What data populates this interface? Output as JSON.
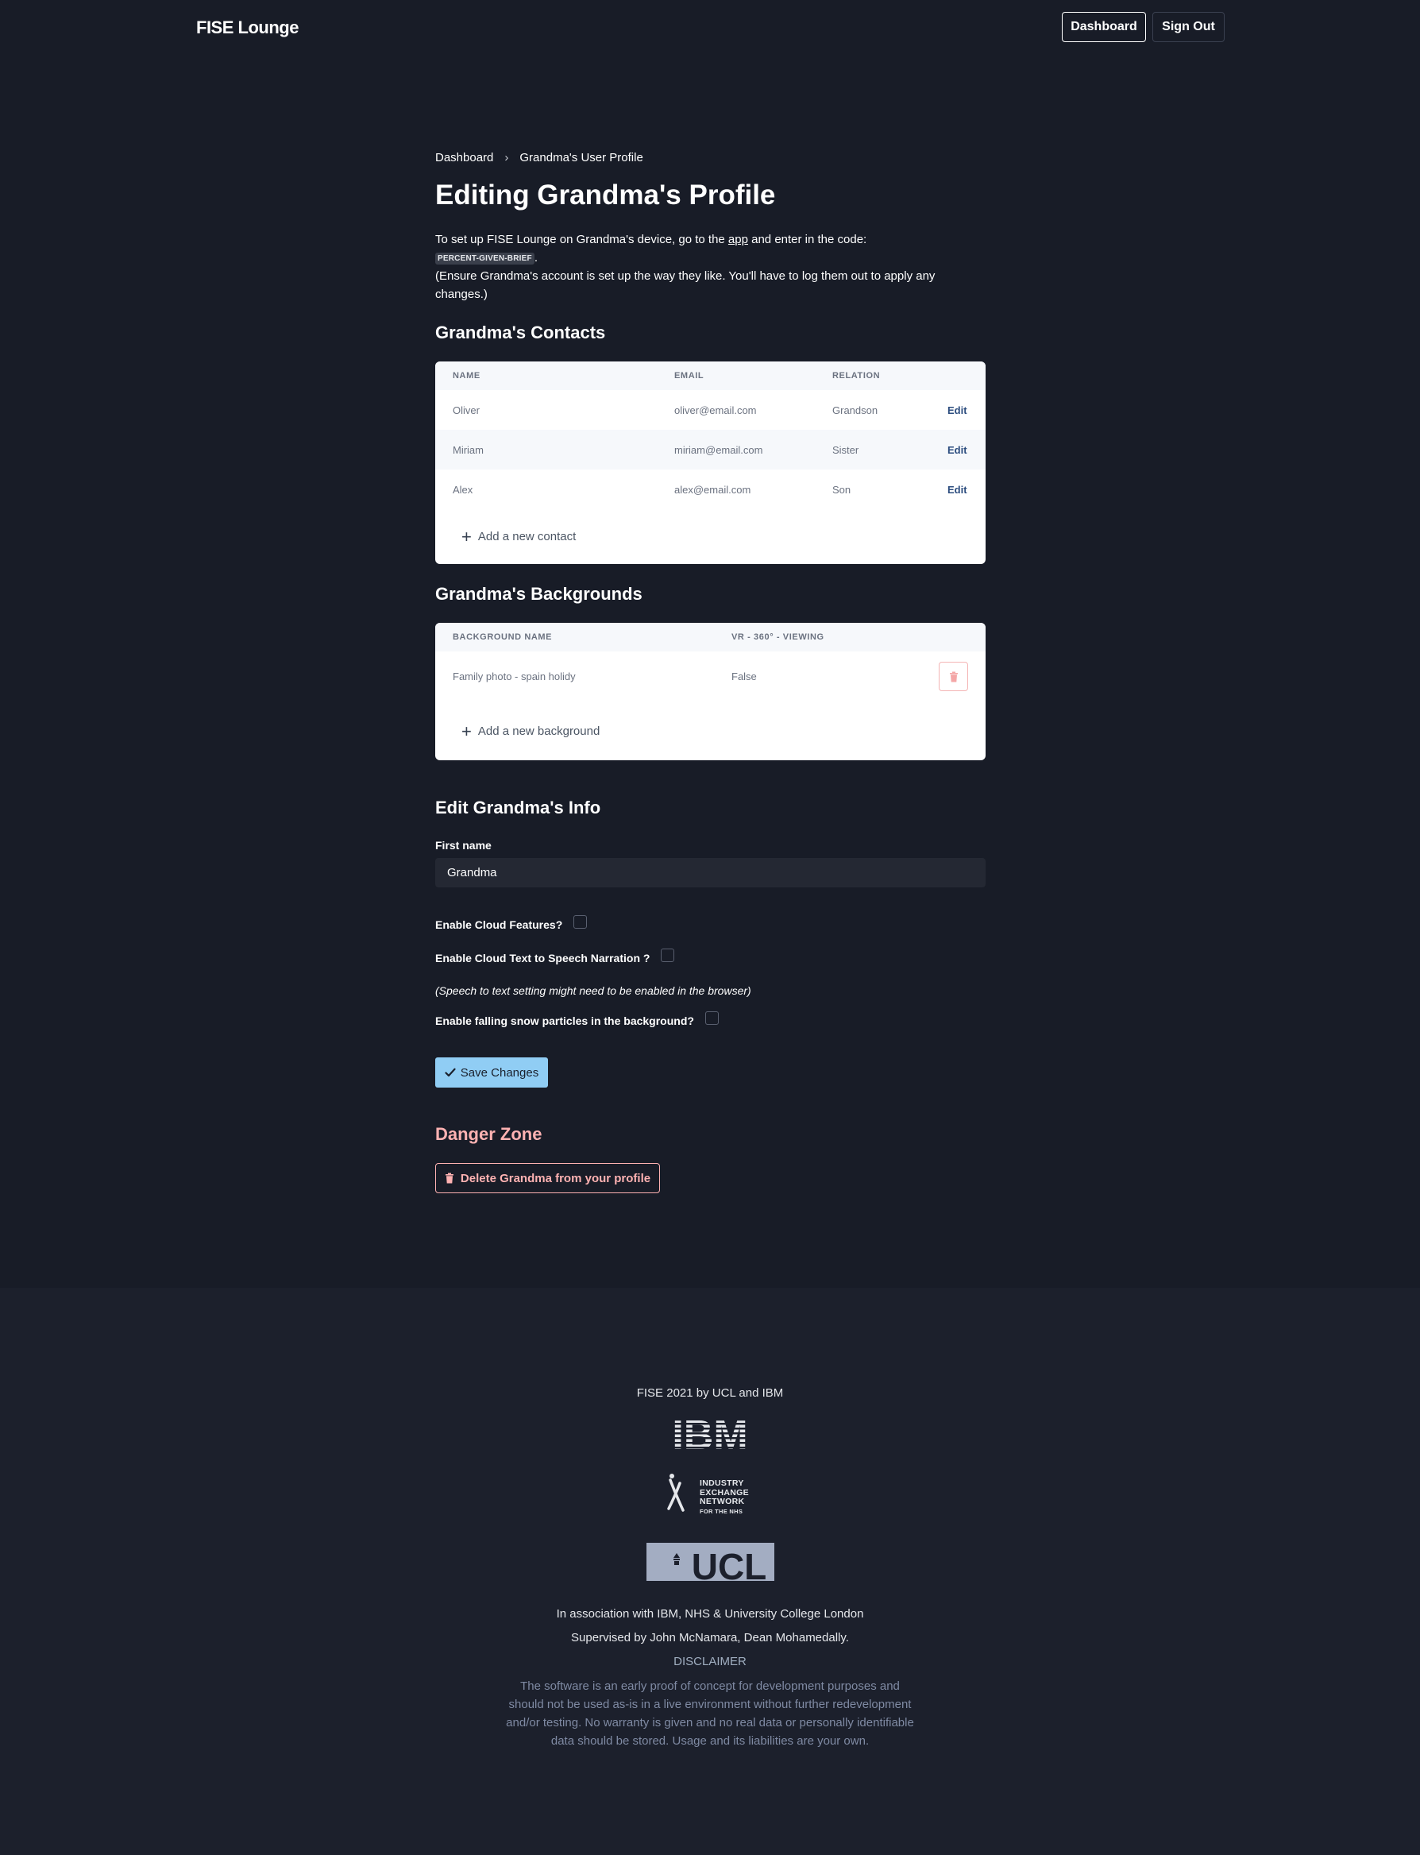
{
  "header": {
    "brand": "FISE Lounge",
    "dashboard_label": "Dashboard",
    "signout_label": "Sign Out"
  },
  "breadcrumb": {
    "home": "Dashboard",
    "separator": "›",
    "current": "Grandma's User Profile"
  },
  "page_title": "Editing Grandma's Profile",
  "intro": {
    "line1_before": "To set up FISE Lounge on Grandma's device, go to the ",
    "app_link": "app",
    "line1_after": " and enter in the code:",
    "code": "PERCENT-GIVEN-BRIEF",
    "code_suffix": ".",
    "line2": "(Ensure Grandma's account is set up the way they like. You'll have to log them out to apply any changes.)"
  },
  "contacts": {
    "heading": "Grandma's Contacts",
    "columns": [
      "NAME",
      "EMAIL",
      "RELATION"
    ],
    "rows": [
      {
        "name": "Oliver",
        "email": "oliver@email.com",
        "relation": "Grandson",
        "action": "Edit"
      },
      {
        "name": "Miriam",
        "email": "miriam@email.com",
        "relation": "Sister",
        "action": "Edit"
      },
      {
        "name": "Alex",
        "email": "alex@email.com",
        "relation": "Son",
        "action": "Edit"
      }
    ],
    "add_label": "Add a new contact"
  },
  "backgrounds": {
    "heading": "Grandma's Backgrounds",
    "columns": [
      "BACKGROUND NAME",
      "VR - 360° - VIEWING"
    ],
    "rows": [
      {
        "name": "Family photo - spain holidy",
        "vr": "False"
      }
    ],
    "add_label": "Add a new background"
  },
  "edit_info": {
    "heading": "Edit Grandma's Info",
    "first_name_label": "First name",
    "first_name_value": "Grandma",
    "cloud_features_label": "Enable Cloud Features?",
    "cloud_tts_label": "Enable Cloud Text to Speech Narration ?",
    "tts_note": "(Speech to text setting might need to be enabled in the browser)",
    "snow_label": "Enable falling snow particles in the background?",
    "save_label": "Save Changes"
  },
  "danger": {
    "heading": "Danger Zone",
    "delete_label": "Delete Grandma from your profile"
  },
  "footer": {
    "credit": "FISE 2021 by UCL and IBM",
    "ibm_logo": "IBM",
    "ixn_logo_lines": [
      "INDUSTRY",
      "EXCHANGE",
      "NETWORK",
      "FOR THE NHS"
    ],
    "ucl_logo": "UCL",
    "association": "In association with IBM, NHS & University College London",
    "supervised": "Supervised by John McNamara, Dean Mohamedally.",
    "disclaimer_title": "DISCLAIMER",
    "disclaimer_text": "The software is an early proof of concept for development purposes and should not be used as-is in a live environment without further redevelopment and/or testing. No warranty is given and no real data or personally identifiable data should be stored. Usage and its liabilities are your own."
  },
  "colors": {
    "page_bg": "#181c27",
    "footer_bg": "#1c202c",
    "accent_blue": "#90cdf4",
    "danger_pink": "#feb2b2",
    "edit_link": "#2b4c7e"
  }
}
